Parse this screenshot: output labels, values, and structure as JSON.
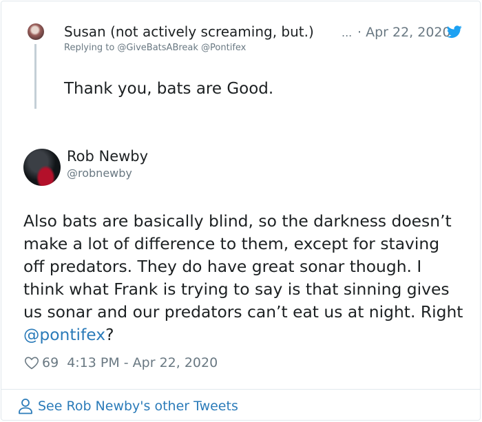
{
  "parent_tweet": {
    "author_name": "Susan (not actively screaming, but.)",
    "ellipsis": "...",
    "date": "· Apr 22, 2020",
    "replying_to": "Replying to @GiveBatsABreak @Pontifex",
    "text": "Thank you, bats are Good."
  },
  "tweet": {
    "author_name": "Rob Newby",
    "author_handle": "@robnewby",
    "text_before_mention": "Also bats are basically blind, so the darkness doesn’t make a lot of difference to them, except for staving off predators. They do have great sonar though. I think what Frank is trying to say is that sinning gives us sonar and our predators can’t eat us at night. Right ",
    "mention": "@pontifex",
    "text_after_mention": "?",
    "likes": "69",
    "timestamp": "4:13 PM - Apr 22, 2020"
  },
  "footer": {
    "label": "See Rob Newby's other Tweets"
  },
  "icons": {
    "brand": "twitter-bird-icon",
    "like": "heart-icon",
    "profile": "person-icon"
  },
  "colors": {
    "link": "#2b7bb9",
    "brand": "#1da1f2",
    "muted": "#697882",
    "text": "#1c2022",
    "border": "#e1e8ed"
  }
}
